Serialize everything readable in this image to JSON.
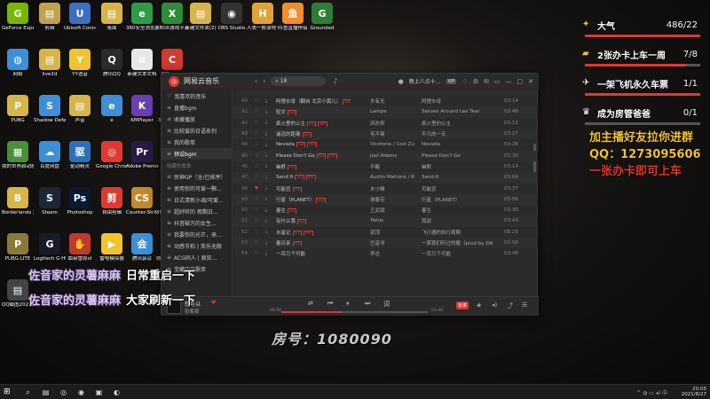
{
  "desktop": {
    "icons": [
      {
        "label": "GeForce Experience",
        "color": "#76b900",
        "glyph": "G"
      },
      {
        "label": "剪辑",
        "color": "#c2a24a",
        "glyph": "▤"
      },
      {
        "label": "Ubisoft Connect",
        "color": "#3c6ec4",
        "glyph": "U"
      },
      {
        "label": "桌面",
        "color": "#d8b449",
        "glyph": "▤"
      },
      {
        "label": "360安全浏览器",
        "color": "#2e9b4a",
        "glyph": "e"
      },
      {
        "label": "XBOX游戏平台-中控",
        "color": "#2e8b3a",
        "glyph": "X"
      },
      {
        "label": "新建文件夹(2)",
        "color": "#d8b449",
        "glyph": "▤"
      },
      {
        "label": "OBS Studio",
        "color": "#333333",
        "glyph": "◉"
      },
      {
        "label": "人类一败涂地 Human Fall Flat",
        "color": "#e4a236",
        "glyph": "H"
      },
      {
        "label": "斗鱼直播伴侣",
        "color": "#f08d2e",
        "glyph": "鱼"
      },
      {
        "label": "Grounded",
        "color": "#2e7d32",
        "glyph": "G"
      },
      {
        "label": "网络",
        "color": "#3d8fd8",
        "glyph": "◍"
      },
      {
        "label": "live2d",
        "color": "#d8b449",
        "glyph": "▤"
      },
      {
        "label": "YY语音",
        "color": "#f2c32e",
        "glyph": "Y"
      },
      {
        "label": "腾讯QQ",
        "color": "#2a2a2a",
        "glyph": "Q"
      },
      {
        "label": "新建文本文档",
        "color": "#e8e8e8",
        "glyph": "≡"
      },
      {
        "label": "CCleaner",
        "color": "#d33a31",
        "glyph": "C"
      },
      {
        "label": "PUBG",
        "color": "#d8b449",
        "glyph": "P"
      },
      {
        "label": "Shadow Defender",
        "color": "#3d8fd8",
        "glyph": "S"
      },
      {
        "label": "声音",
        "color": "#d8b449",
        "glyph": "▤"
      },
      {
        "label": "e",
        "color": "#3d8fd8",
        "glyph": "e"
      },
      {
        "label": "KMPlayer",
        "color": "#6a3fb5",
        "glyph": "K"
      },
      {
        "label": "360安全卫士",
        "color": "#2e9b4a",
        "glyph": "+"
      },
      {
        "label": "我的世界启动器",
        "color": "#4a8f3a",
        "glyph": "▦"
      },
      {
        "label": "百度网盘",
        "color": "#3d8fd8",
        "glyph": "☁"
      },
      {
        "label": "驱动精灵",
        "color": "#2e6fb8",
        "glyph": "驱"
      },
      {
        "label": "Google Chrome",
        "color": "#e0392f",
        "glyph": "◎"
      },
      {
        "label": "Adobe Premiere",
        "color": "#2a1a4a",
        "glyph": "Pr"
      },
      {
        "label": "Minecraft",
        "color": "#5a7a3a",
        "glyph": "▦"
      },
      {
        "label": "Borderlands 2",
        "color": "#d8b449",
        "glyph": "B"
      },
      {
        "label": "Steam",
        "color": "#1b2838",
        "glyph": "S"
      },
      {
        "label": "Photoshop",
        "color": "#0a1a33",
        "glyph": "Ps"
      },
      {
        "label": "自由剪辑",
        "color": "#e0392f",
        "glyph": "剪"
      },
      {
        "label": "Counter-Strike Global Off",
        "color": "#c28a2e",
        "glyph": "CS"
      },
      {
        "label": "360游戏大厅 v4.1",
        "color": "#3d8fd8",
        "glyph": "游"
      },
      {
        "label": "PUBG LITE",
        "color": "#8a7a3a",
        "glyph": "P"
      },
      {
        "label": "Logitech G HUB",
        "color": "#1a1a2a",
        "glyph": "G"
      },
      {
        "label": "血染雪原ol",
        "color": "#c0392b",
        "glyph": "✋"
      },
      {
        "label": "雷电模拟器",
        "color": "#f2c32e",
        "glyph": "▶"
      },
      {
        "label": "腾讯会议",
        "color": "#3d8fd8",
        "glyph": "会"
      },
      {
        "label": "微信小程序客户端",
        "color": "#d8d0c0",
        "glyph": "☺"
      },
      {
        "label": "QQ截图20210827...",
        "color": "#444444",
        "glyph": "▤"
      }
    ],
    "room_number": "房号：1080090",
    "banner_left_1": "佐音家的灵薯麻麻",
    "banner_left_1_suffix": "日常重启一下",
    "banner_left_2": "佐音家的灵薯麻麻",
    "banner_left_2_suffix": "大家刷新一下"
  },
  "overlay": {
    "goals": [
      {
        "name": "大气",
        "count": "486/22",
        "fill": 1.0,
        "icon": "stars-icon",
        "glyph": "✦",
        "color": "#f2c32e"
      },
      {
        "name": "2张办卡上车一周",
        "count": "7/8",
        "fill": 0.875,
        "icon": "card-icon",
        "glyph": "▰",
        "color": "#f2c32e"
      },
      {
        "name": "一架飞机永久车票",
        "count": "1/1",
        "fill": 1.0,
        "icon": "plane-icon",
        "glyph": "✈",
        "color": "#ffffff"
      },
      {
        "name": "成为房管爸爸",
        "count": "0/1",
        "fill": 0.0,
        "icon": "trophy-icon",
        "glyph": "♛",
        "color": "#ffffff"
      }
    ],
    "promo_line1": "加主播好友拉你进群",
    "promo_line2": "QQ：1273095606",
    "promo_line3": "一张办卡即可上车",
    "promo_colors": {
      "line1": "#f2c32e",
      "line2": "#f2c32e",
      "line3": "#e0392f"
    }
  },
  "app": {
    "title": "网易云音乐",
    "search_value": "18",
    "username": "晚上八点十...",
    "vip": "VIP",
    "accent": "#d33a31",
    "sidebar": [
      {
        "type": "item",
        "label": "我喜欢的音乐",
        "icon": "heart-icon",
        "glyph": "♡"
      },
      {
        "type": "item",
        "label": "直播bgm",
        "icon": "playlist-icon",
        "glyph": "≡"
      },
      {
        "type": "item",
        "label": "收藏播放",
        "icon": "playlist-icon",
        "glyph": "≡"
      },
      {
        "type": "item",
        "label": "比较爱的日语系列",
        "icon": "playlist-icon",
        "glyph": "≡"
      },
      {
        "type": "item",
        "label": "我的歌单",
        "icon": "playlist-icon",
        "glyph": "≡"
      },
      {
        "type": "item",
        "label": "预设bgm",
        "icon": "playlist-icon",
        "glyph": "≡",
        "active": true
      },
      {
        "type": "head",
        "label": "收藏的歌单"
      },
      {
        "type": "item",
        "label": "民神OP（全/已排序）",
        "icon": "playlist-icon",
        "glyph": "≡"
      },
      {
        "type": "item",
        "label": "使用你的可爱一颗...",
        "icon": "playlist-icon",
        "glyph": "≡"
      },
      {
        "type": "item",
        "label": "日式清新小调/可爱...",
        "icon": "playlist-icon",
        "glyph": "≡"
      },
      {
        "type": "item",
        "label": "超好听的 假期日...",
        "icon": "playlist-icon",
        "glyph": "≡"
      },
      {
        "type": "item",
        "label": "抖音破万的女生...",
        "icon": "playlist-icon",
        "glyph": "≡"
      },
      {
        "type": "item",
        "label": "我要你的光芒，来...",
        "icon": "playlist-icon",
        "glyph": "≡"
      },
      {
        "type": "item",
        "label": "动感节拍 | 英乐无限",
        "icon": "playlist-icon",
        "glyph": "≡"
      },
      {
        "type": "item",
        "label": "ACG同人 | 疯狂...",
        "icon": "playlist-icon",
        "glyph": "≡"
      },
      {
        "type": "item",
        "label": "宝藏中文歌单",
        "icon": "playlist-icon",
        "glyph": "≡"
      }
    ],
    "tracks": [
      {
        "num": "40",
        "name": "阿狸水母（翻自 北京小黄儿）",
        "tags": [
          "SQ"
        ],
        "artist": "木有无",
        "album": "阿狸水母",
        "dur": "03:14",
        "liked": false
      },
      {
        "num": "41",
        "name": "轻文",
        "tags": [
          "SQ"
        ],
        "artist": "Lampe",
        "album": "Senses Around Lee Tear",
        "dur": "03:46",
        "liked": false
      },
      {
        "num": "42",
        "name": "疯火里的公主",
        "tags": [
          "SQ",
          "MV"
        ],
        "artist": "风吹来",
        "album": "疯火里的公主",
        "dur": "03:12",
        "liked": false
      },
      {
        "num": "43",
        "name": "遥远的距离",
        "tags": [
          "SQ"
        ],
        "artist": "毛不易",
        "album": "平凡的一天",
        "dur": "03:27",
        "liked": false
      },
      {
        "num": "44",
        "name": "Nevada",
        "tags": [
          "SQ",
          "MV"
        ],
        "artist": "Vicetone / Cozi Zuh",
        "album": "Nevada",
        "dur": "03:28",
        "liked": false
      },
      {
        "num": "45",
        "name": "Please Don't Go",
        "tags": [
          "SQ",
          "MV"
        ],
        "artist": "Joel Adams",
        "album": "Please Don't Go",
        "dur": "03:30",
        "liked": false
      },
      {
        "num": "46",
        "name": "幽默",
        "tags": [
          "SQ"
        ],
        "artist": "不醒",
        "album": "幽默",
        "dur": "03:14",
        "liked": false
      },
      {
        "num": "47",
        "name": "Send It",
        "tags": [
          "SQ",
          "MV"
        ],
        "artist": "Austin Mahone / Ri.",
        "album": "Send It",
        "dur": "03:04",
        "liked": false
      },
      {
        "num": "48",
        "name": "可能否",
        "tags": [
          "SQ"
        ],
        "artist": "木小雅",
        "album": "可能否",
        "dur": "03:37",
        "liked": true
      },
      {
        "num": "49",
        "name": "行星（PLANET）",
        "tags": [
          "SQ"
        ],
        "artist": "谢春花",
        "album": "行星（PLANET）",
        "dur": "03:56",
        "liked": false
      },
      {
        "num": "50",
        "name": "春生",
        "tags": [
          "SQ"
        ],
        "artist": "王武斌",
        "album": "春生",
        "dur": "03:30",
        "liked": false
      },
      {
        "num": "51",
        "name": "有什么我",
        "tags": [
          "SQ"
        ],
        "artist": "Twins",
        "album": "我就",
        "dur": "03:43",
        "liked": false
      },
      {
        "num": "52",
        "name": "水星记",
        "tags": [
          "SQ",
          "MV"
        ],
        "artist": "郭顶",
        "album": "飞行器的执行周期",
        "dur": "05:25",
        "liked": false
      },
      {
        "num": "53",
        "name": "春日亲",
        "tags": [
          "SQ"
        ],
        "artist": "巴音洋",
        "album": "一首我们听过的歌（prod by DRO...",
        "dur": "02:56",
        "liked": false
      },
      {
        "num": "54",
        "name": "一百万个可能",
        "tags": [],
        "artist": "李志",
        "album": "一百万个可能",
        "dur": "03:48",
        "liked": false
      }
    ],
    "player": {
      "now_title": "想可以",
      "now_artist": "张紫豪",
      "time_current": "00:58",
      "time_total": "03:48",
      "progress": 0.41,
      "lyric_label": "标准"
    }
  },
  "taskbar": {
    "time": "20:05",
    "date": "2021/8/27",
    "tray_text": "^ ◍ ▭ ◂) 中"
  }
}
